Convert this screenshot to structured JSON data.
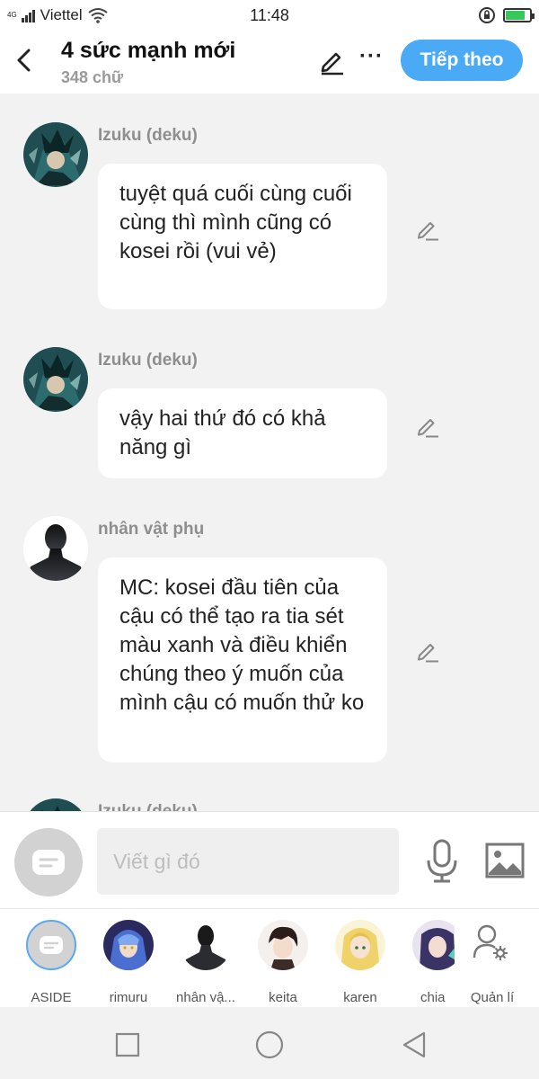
{
  "status_bar": {
    "network_type": "4G",
    "carrier": "Viettel",
    "time": "11:48",
    "battery_level": 0.8
  },
  "header": {
    "title": "4 sức mạnh mới",
    "subtitle": "348 chữ",
    "next_label": "Tiếp theo"
  },
  "messages": [
    {
      "sender": "Izuku (deku)",
      "text": "tuyệt quá cuối cùng cuối cùng thì mình cũng có kosei rồi (vui vẻ)"
    },
    {
      "sender": "Izuku (deku)",
      "text": "vậy hai thứ đó có khả năng gì"
    },
    {
      "sender": "nhân vật phụ",
      "text": "MC: kosei đầu tiên của cậu có thể tạo ra tia sét màu xanh và điều khiển chúng theo ý muốn của mình cậu có muốn thử ko"
    },
    {
      "sender": "Izuku (deku)",
      "text": ""
    }
  ],
  "composer": {
    "placeholder": "Viết gì đó"
  },
  "characters": [
    {
      "label": "ASIDE"
    },
    {
      "label": "rimuru"
    },
    {
      "label": "nhân vậ..."
    },
    {
      "label": "keita"
    },
    {
      "label": "karen"
    },
    {
      "label": "chia"
    }
  ],
  "manage_label": "Quản lí",
  "colors": {
    "accent": "#4aaaf6",
    "background": "#f2f2f2"
  }
}
